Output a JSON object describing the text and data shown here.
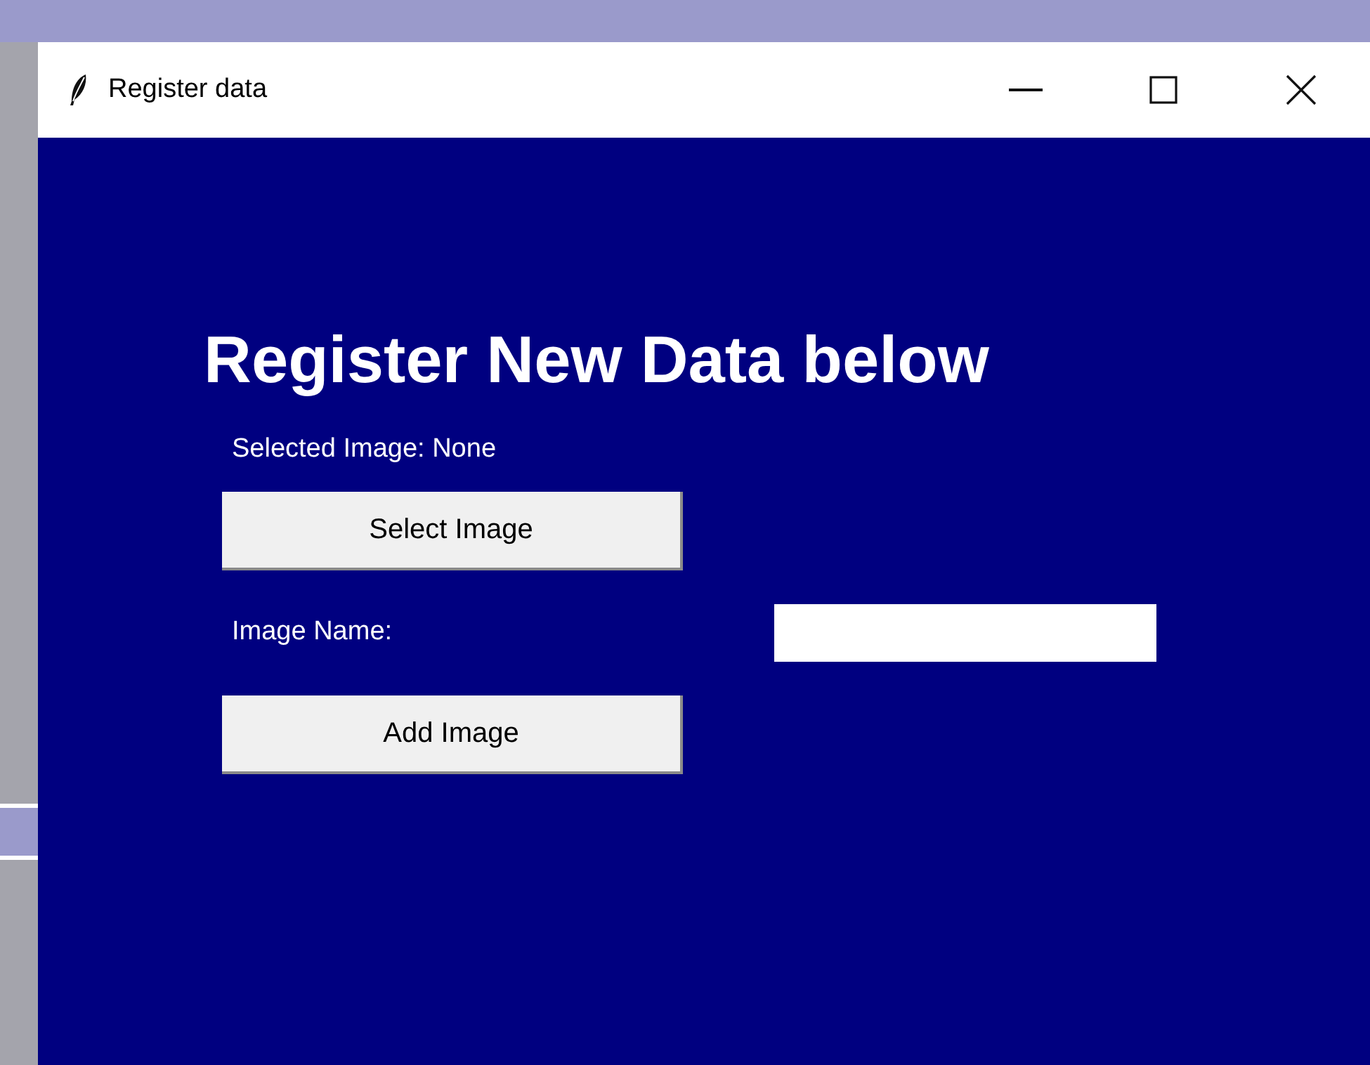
{
  "window": {
    "title": "Register data"
  },
  "heading": "Register New Data below",
  "selected_image_label": "Selected Image: None",
  "select_button": "Select Image",
  "image_name_label": "Image Name:",
  "add_button": "Add Image"
}
